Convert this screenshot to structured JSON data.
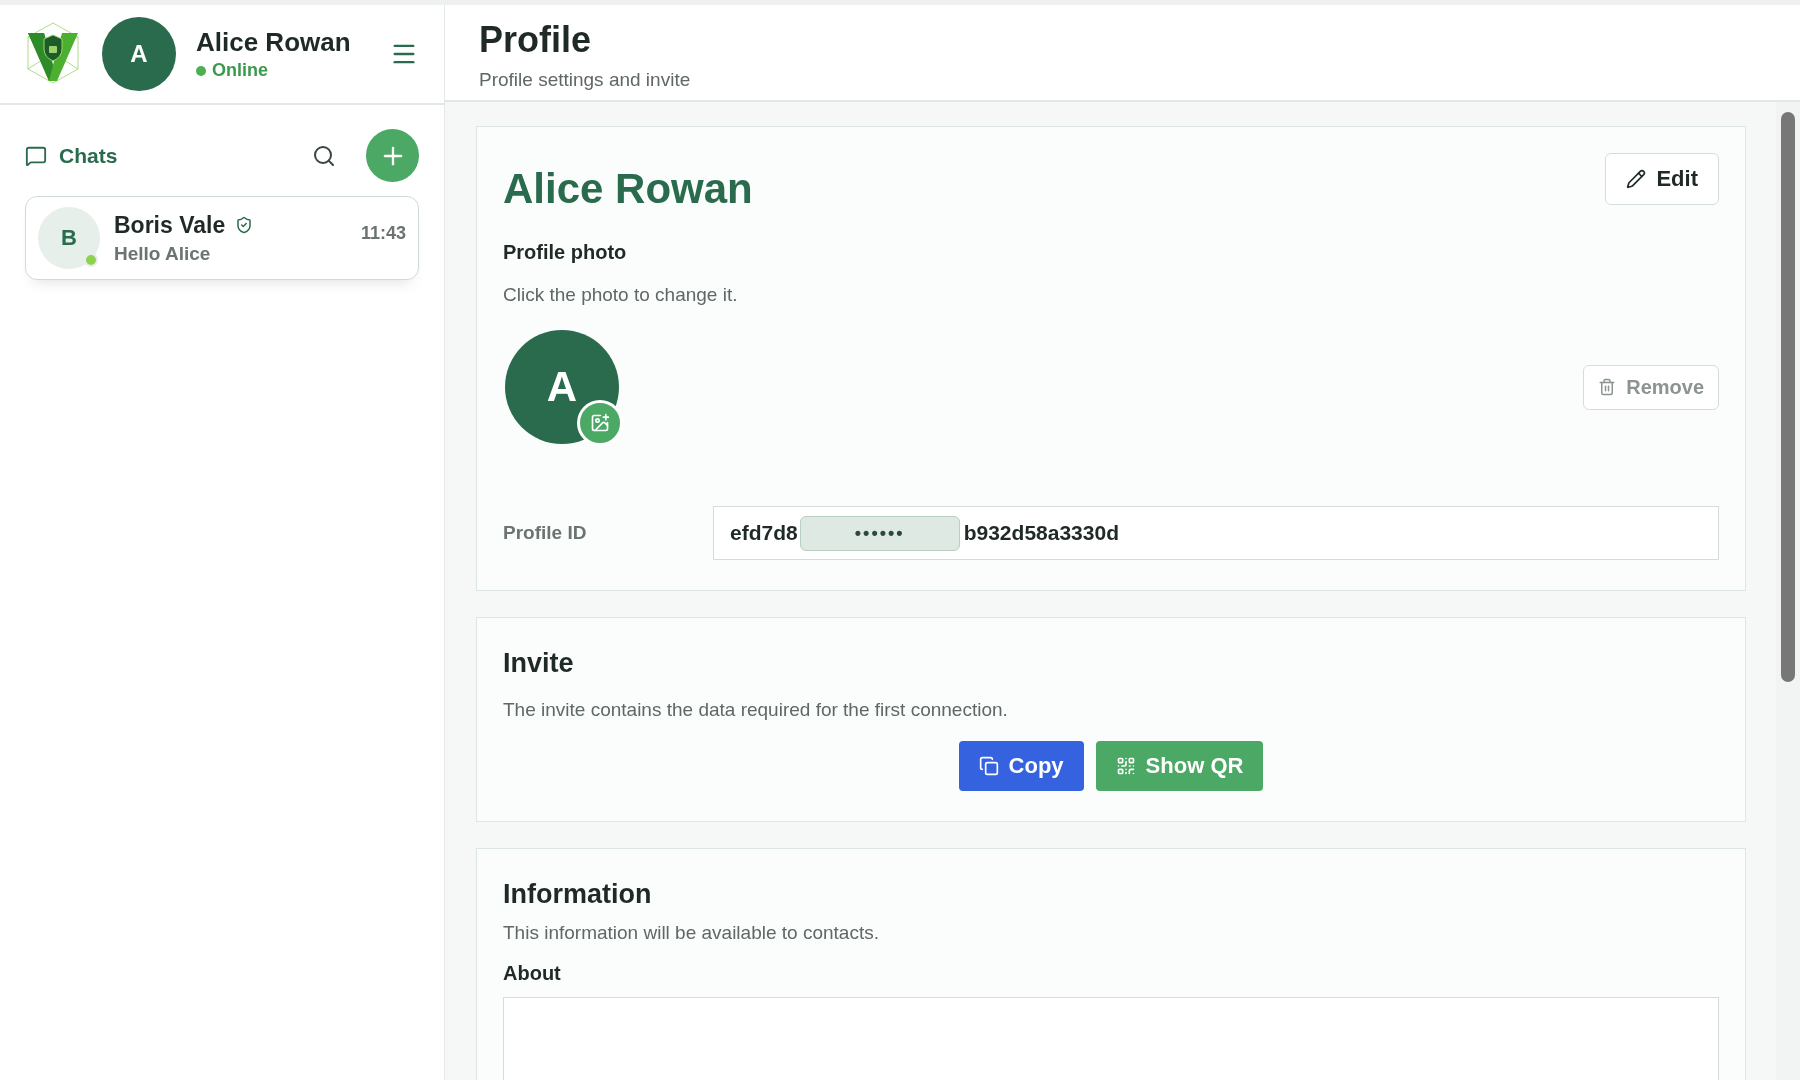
{
  "sidebar": {
    "user": {
      "avatar_letter": "A",
      "name": "Alice Rowan",
      "status": "Online",
      "online": true
    },
    "chats_title": "Chats",
    "chats": [
      {
        "avatar_letter": "B",
        "name": "Boris Vale",
        "verified": true,
        "online": true,
        "last_message": "Hello Alice",
        "time": "11:43",
        "selected": false
      }
    ]
  },
  "header": {
    "title": "Profile",
    "subtitle": "Profile settings and invite"
  },
  "profile": {
    "name": "Alice Rowan",
    "edit_label": "Edit",
    "photo_title": "Profile photo",
    "photo_hint": "Click the photo to change it.",
    "avatar_letter": "A",
    "remove_label": "Remove",
    "remove_disabled": true,
    "id_label": "Profile ID",
    "id_start": "efd7d8",
    "id_mask": "••••••",
    "id_end": "b932d58a3330d"
  },
  "invite": {
    "title": "Invite",
    "description": "The invite contains the data required for the first connection.",
    "buttons": [
      {
        "kind": "copy",
        "label": "Copy"
      },
      {
        "kind": "qr",
        "label": "Show QR"
      }
    ]
  },
  "information": {
    "title": "Information",
    "description": "This information will be available to contacts.",
    "about_label": "About"
  }
}
